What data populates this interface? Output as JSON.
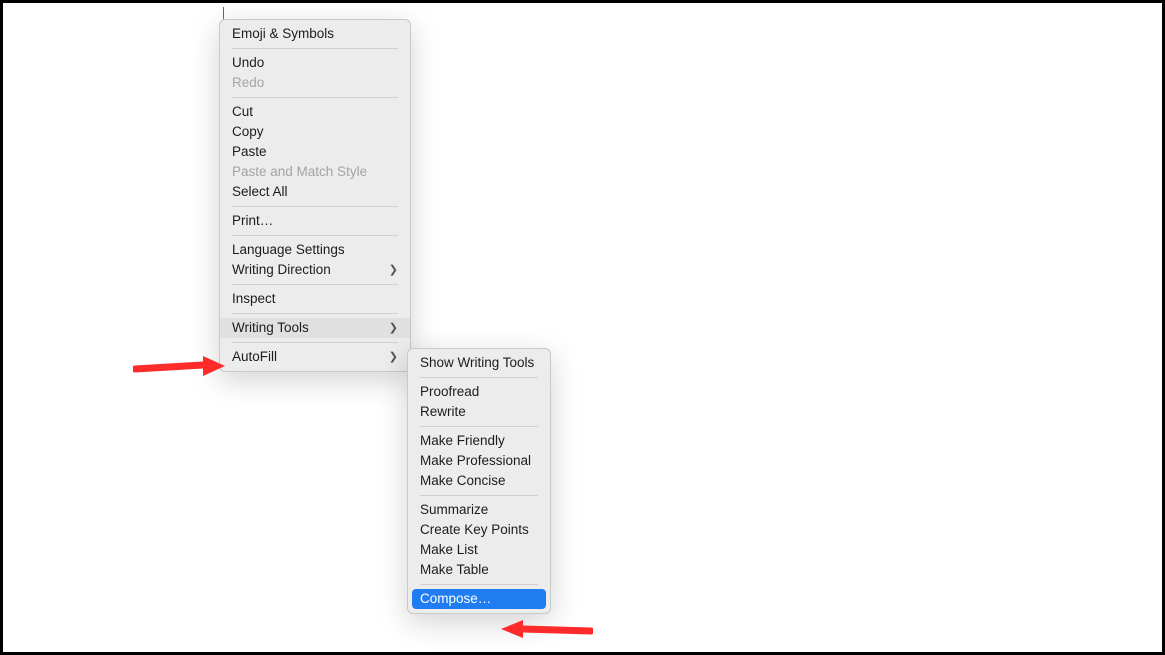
{
  "mainMenu": {
    "emojiSymbols": "Emoji & Symbols",
    "undo": "Undo",
    "redo": "Redo",
    "cut": "Cut",
    "copy": "Copy",
    "paste": "Paste",
    "pasteMatchStyle": "Paste and Match Style",
    "selectAll": "Select All",
    "print": "Print…",
    "languageSettings": "Language Settings",
    "writingDirection": "Writing Direction",
    "inspect": "Inspect",
    "writingTools": "Writing Tools",
    "autoFill": "AutoFill"
  },
  "subMenu": {
    "showWritingTools": "Show Writing Tools",
    "proofread": "Proofread",
    "rewrite": "Rewrite",
    "makeFriendly": "Make Friendly",
    "makeProfessional": "Make Professional",
    "makeConcise": "Make Concise",
    "summarize": "Summarize",
    "createKeyPoints": "Create Key Points",
    "makeList": "Make List",
    "makeTable": "Make Table",
    "compose": "Compose…"
  },
  "colors": {
    "highlightBlue": "#1f7df1",
    "arrowRed": "#ff2a2a"
  }
}
